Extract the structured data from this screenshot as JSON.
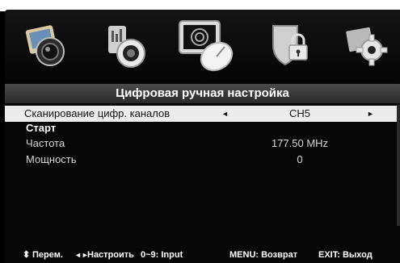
{
  "menu": {
    "icons": [
      {
        "name": "picture-icon"
      },
      {
        "name": "sound-icon"
      },
      {
        "name": "channel-dish-icon",
        "active": true
      },
      {
        "name": "lock-icon"
      },
      {
        "name": "settings-gear-icon"
      }
    ]
  },
  "title": "Цифровая ручная настройка",
  "rows": [
    {
      "label": "Сканирование цифр. каналов",
      "value": "CH5",
      "left_arrow": "◄",
      "right_arrow": "►"
    },
    {
      "label": "Старт",
      "value": ""
    },
    {
      "label": "Частота",
      "value": "177.50 MHz"
    },
    {
      "label": "Мощность",
      "value": "0"
    }
  ],
  "footer": {
    "nav_icon": "⬍",
    "move": "Перем.",
    "adjust_icon": "◄►",
    "adjust": "Настроить",
    "input": "0~9: Input",
    "menu": "MENU: Возврат",
    "exit": "EXIT: Выход"
  },
  "colors": {
    "background": "#070707",
    "title_bar": "#3a3a3a",
    "selected_row": "#ececec"
  }
}
